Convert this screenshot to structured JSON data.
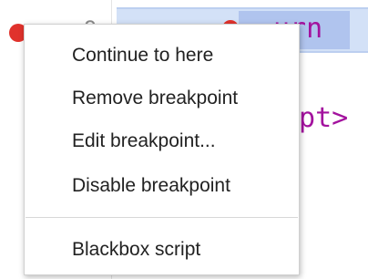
{
  "editor": {
    "line_number": "9",
    "code_lines": [
      "urn",
      "ipt>"
    ]
  },
  "context_menu": {
    "items": [
      {
        "label": "Continue to here"
      },
      {
        "label": "Remove breakpoint"
      },
      {
        "label": "Edit breakpoint..."
      },
      {
        "label": "Disable breakpoint"
      },
      {
        "label": "Blackbox script"
      }
    ]
  },
  "colors": {
    "breakpoint": "#e0322c",
    "execution_line_bg": "#d3e1f7",
    "selection_bg": "#b0c4ee",
    "keyword": "#a3129e"
  }
}
